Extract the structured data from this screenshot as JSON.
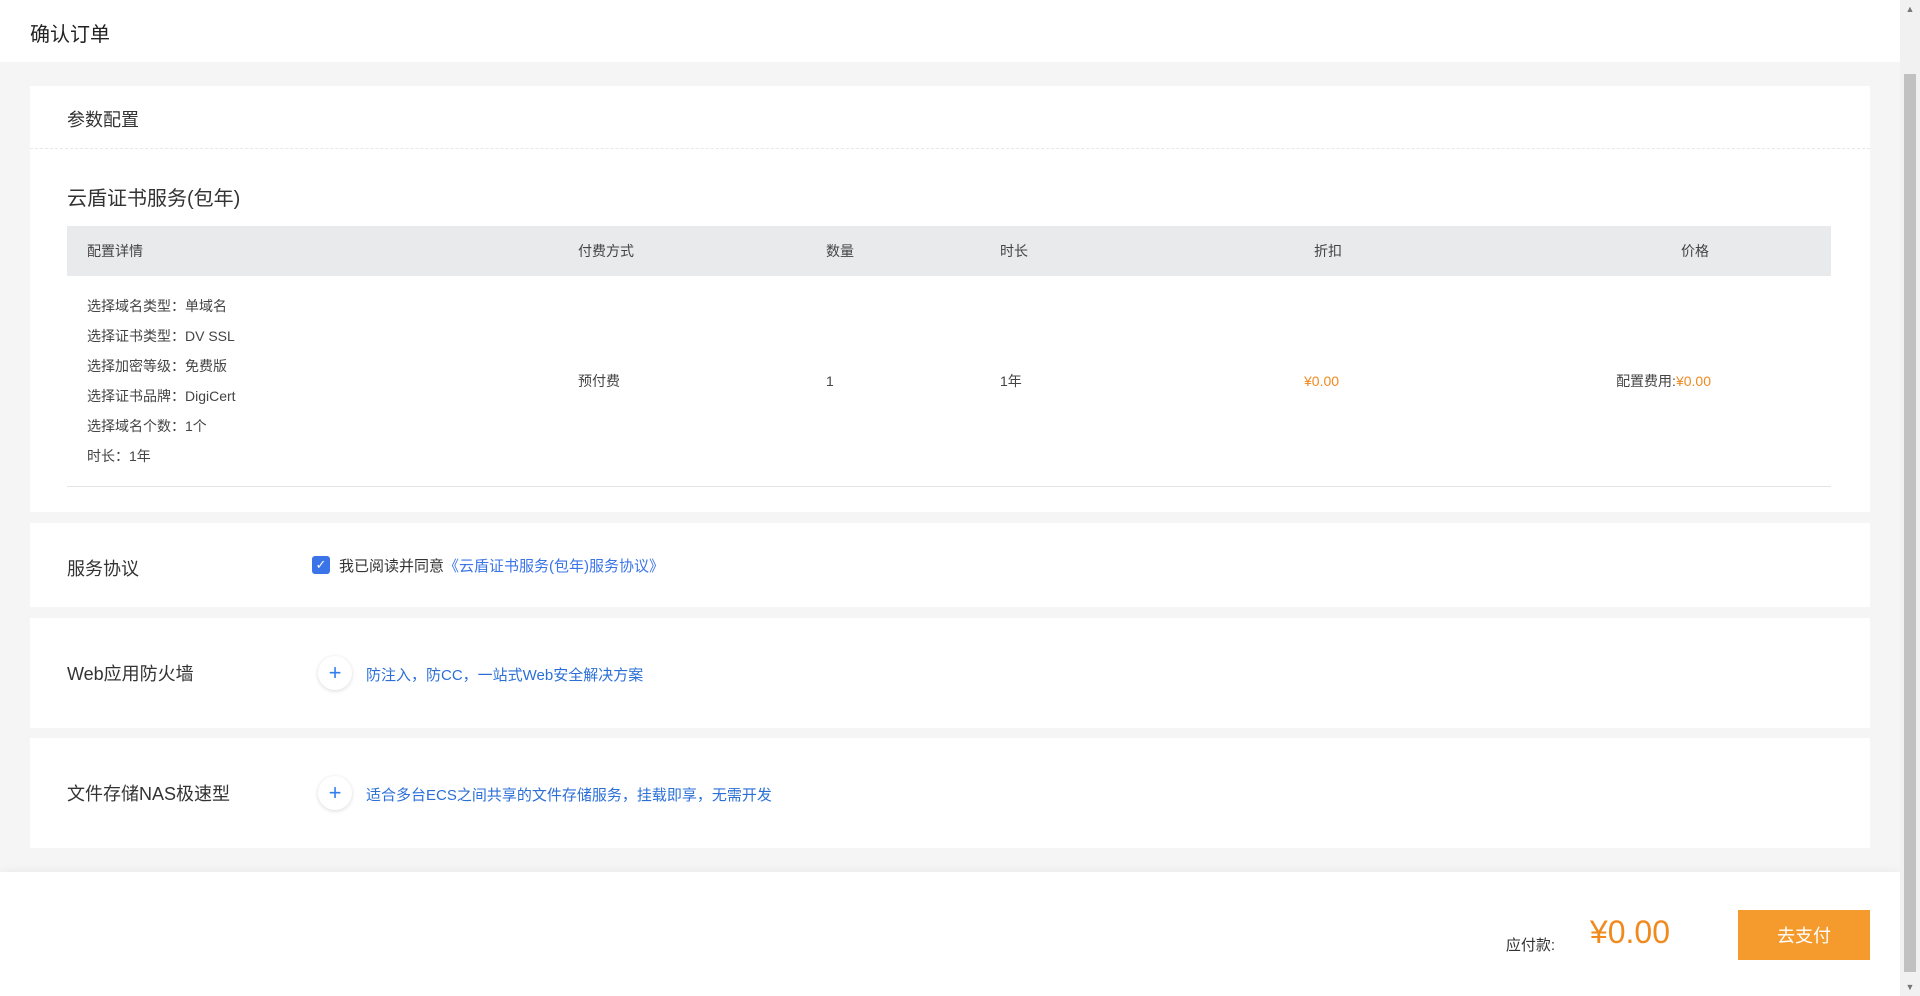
{
  "header": {
    "title": "确认订单"
  },
  "params": {
    "section_title": "参数配置",
    "product_name": "云盾证书服务(包年)",
    "table": {
      "headers": {
        "detail": "配置详情",
        "payment": "付费方式",
        "quantity": "数量",
        "duration": "时长",
        "discount": "折扣",
        "price": "价格"
      },
      "details": [
        "选择域名类型：单域名",
        "选择证书类型：DV SSL",
        "选择加密等级：免费版",
        "选择证书品牌：DigiCert",
        "选择域名个数：1个",
        "时长：1年"
      ],
      "row": {
        "payment": "预付费",
        "quantity": "1",
        "duration": "1年",
        "discount": "¥0.00",
        "price_label": "配置费用:",
        "price_value": "¥0.00"
      }
    }
  },
  "agreement": {
    "label": "服务协议",
    "checked": true,
    "text": "我已阅读并同意",
    "link": "《云盾证书服务(包年)服务协议》"
  },
  "addons": [
    {
      "label": "Web应用防火墙",
      "description": "防注入，防CC，一站式Web安全解决方案"
    },
    {
      "label": "文件存储NAS极速型",
      "description": "适合多台ECS之间共享的文件存储服务，挂载即享，无需开发"
    }
  ],
  "footer": {
    "payable_label": "应付款:",
    "payable_amount": "¥0.00",
    "pay_button": "去支付"
  },
  "colors": {
    "accent_orange": "#f08a1f",
    "pay_button": "#f59b2e",
    "link_blue": "#3b74e8",
    "header_bg": "#e9eaec"
  },
  "icons": {
    "checkbox": "check-icon",
    "add": "plus-icon",
    "scroll_up": "chevron-up-icon",
    "scroll_down": "chevron-down-icon"
  }
}
